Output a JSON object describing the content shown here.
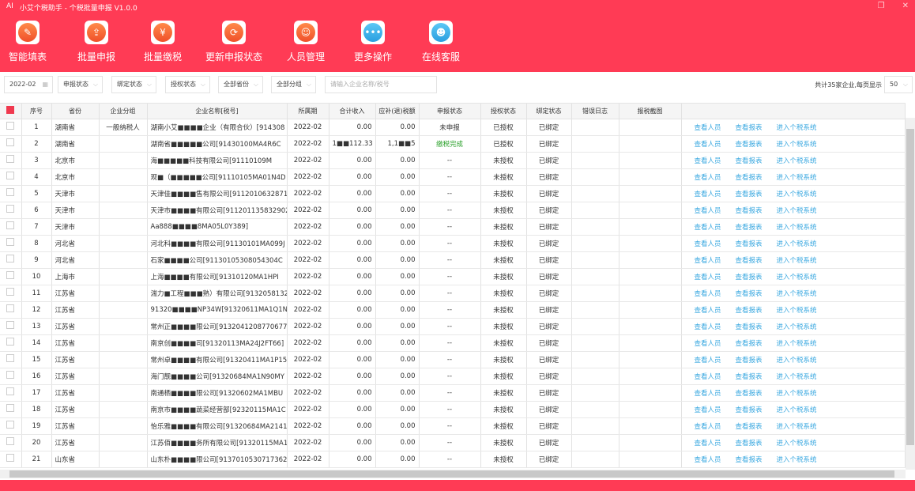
{
  "app": {
    "logo": "AI",
    "title": "小艾个税助手 - 个税批量申报  V1.0.0"
  },
  "window": {
    "restore": "❐",
    "close": "✕"
  },
  "toolbar": [
    {
      "label": "智能填表",
      "icon": "form-edit-icon",
      "glyph": "✎",
      "color": "orange"
    },
    {
      "label": "批量申报",
      "icon": "document-upload-icon",
      "glyph": "⇪",
      "color": "orange"
    },
    {
      "label": "批量缴税",
      "icon": "payment-hand-icon",
      "glyph": "¥",
      "color": "orange"
    },
    {
      "label": "更新申报状态",
      "icon": "refresh-icon",
      "glyph": "⟳",
      "color": "orange"
    },
    {
      "label": "人员管理",
      "icon": "user-settings-icon",
      "glyph": "☺",
      "color": "orange"
    },
    {
      "label": "更多操作",
      "icon": "more-icon",
      "glyph": "•••",
      "color": "blue"
    },
    {
      "label": "在线客服",
      "icon": "chat-icon",
      "glyph": "☻",
      "color": "blue"
    }
  ],
  "filters": {
    "period": "2022-02",
    "declare_status": "申报状态",
    "bind_status": "绑定状态",
    "auth_status": "授权状态",
    "province": "全部省份",
    "group": "全部分组",
    "search_placeholder": "请输入企业名称/税号",
    "total": "共计35家企业,每页显示",
    "page_size": "50"
  },
  "columns": [
    "序号",
    "省份",
    "企业分组",
    "企业名称[税号]",
    "所属期",
    "合计收入",
    "应补(退)税额",
    "申报状态",
    "授权状态",
    "绑定状态",
    "错误日志",
    "报税截图"
  ],
  "actions": [
    "查看人员",
    "查看报表",
    "进入个税系统"
  ],
  "colors": {
    "brand": "#ff3b55",
    "link": "#3aa8e0",
    "done": "#2aa02a"
  },
  "rows": [
    {
      "no": "1",
      "province": "湖南省",
      "group": "一般纳税人",
      "name": "湖南小艾■■■■企业（有限合伙）[914308",
      "period": "2022-02",
      "income": "0.00",
      "tax": "0.00",
      "declare": "未申报",
      "auth": "已授权",
      "bind": "已绑定"
    },
    {
      "no": "2",
      "province": "湖南省",
      "group": "",
      "name": "湖南省■■■■■公司[91430100MA4R6C",
      "period": "2022-02",
      "income": "1■■112.33",
      "tax": "1,1■■5",
      "declare": "缴税完成",
      "auth": "已授权",
      "bind": "已绑定"
    },
    {
      "no": "3",
      "province": "北京市",
      "group": "",
      "name": "海■■■■■科技有限公司[91110109M",
      "period": "2022-02",
      "income": "0.00",
      "tax": "0.00",
      "declare": "--",
      "auth": "未授权",
      "bind": "已绑定"
    },
    {
      "no": "4",
      "province": "北京市",
      "group": "",
      "name": "观■（■■■■■公司[91110105MA01N4D",
      "period": "2022-02",
      "income": "0.00",
      "tax": "0.00",
      "declare": "--",
      "auth": "未授权",
      "bind": "已绑定"
    },
    {
      "no": "5",
      "province": "天津市",
      "group": "",
      "name": "天津佳■■■■售有限公司[9112010632871",
      "period": "2022-02",
      "income": "0.00",
      "tax": "0.00",
      "declare": "--",
      "auth": "未授权",
      "bind": "已绑定"
    },
    {
      "no": "6",
      "province": "天津市",
      "group": "",
      "name": "天津市■■■■有限公司[911201135832902",
      "period": "2022-02",
      "income": "0.00",
      "tax": "0.00",
      "declare": "--",
      "auth": "未授权",
      "bind": "已绑定"
    },
    {
      "no": "7",
      "province": "天津市",
      "group": "",
      "name": "Aa888■■■■8MA05L0Y389]",
      "period": "2022-02",
      "income": "0.00",
      "tax": "0.00",
      "declare": "--",
      "auth": "未授权",
      "bind": "已绑定"
    },
    {
      "no": "8",
      "province": "河北省",
      "group": "",
      "name": "河北科■■■■有限公司[91130101MA099J",
      "period": "2022-02",
      "income": "0.00",
      "tax": "0.00",
      "declare": "--",
      "auth": "未授权",
      "bind": "已绑定"
    },
    {
      "no": "9",
      "province": "河北省",
      "group": "",
      "name": "石家■■■■公司[91130105308054304C",
      "period": "2022-02",
      "income": "0.00",
      "tax": "0.00",
      "declare": "--",
      "auth": "未授权",
      "bind": "已绑定"
    },
    {
      "no": "10",
      "province": "上海市",
      "group": "",
      "name": "上海■■■■有限公司[91310120MA1HPI",
      "period": "2022-02",
      "income": "0.00",
      "tax": "0.00",
      "declare": "--",
      "auth": "未授权",
      "bind": "已绑定"
    },
    {
      "no": "11",
      "province": "江苏省",
      "group": "",
      "name": "湍力■工程■■■熟）有限公司[913205813291",
      "period": "2022-02",
      "income": "0.00",
      "tax": "0.00",
      "declare": "--",
      "auth": "未授权",
      "bind": "已绑定"
    },
    {
      "no": "12",
      "province": "江苏省",
      "group": "",
      "name": "91320■■■■NP34W[91320611MA1Q1NF",
      "period": "2022-02",
      "income": "0.00",
      "tax": "0.00",
      "declare": "--",
      "auth": "未授权",
      "bind": "已绑定"
    },
    {
      "no": "13",
      "province": "江苏省",
      "group": "",
      "name": "常州正■■■■限公司[91320412087706777",
      "period": "2022-02",
      "income": "0.00",
      "tax": "0.00",
      "declare": "--",
      "auth": "未授权",
      "bind": "已绑定"
    },
    {
      "no": "14",
      "province": "江苏省",
      "group": "",
      "name": "南京创■■■■司[91320113MA24J2FT66]",
      "period": "2022-02",
      "income": "0.00",
      "tax": "0.00",
      "declare": "--",
      "auth": "未授权",
      "bind": "已绑定"
    },
    {
      "no": "15",
      "province": "江苏省",
      "group": "",
      "name": "常州卓■■■■有限公司[91320411MA1P15",
      "period": "2022-02",
      "income": "0.00",
      "tax": "0.00",
      "declare": "--",
      "auth": "未授权",
      "bind": "已绑定"
    },
    {
      "no": "16",
      "province": "江苏省",
      "group": "",
      "name": "海门靓■■■■公司[91320684MA1N90MY",
      "period": "2022-02",
      "income": "0.00",
      "tax": "0.00",
      "declare": "--",
      "auth": "未授权",
      "bind": "已绑定"
    },
    {
      "no": "17",
      "province": "江苏省",
      "group": "",
      "name": "南通栖■■■■限公司[91320602MA1MBU",
      "period": "2022-02",
      "income": "0.00",
      "tax": "0.00",
      "declare": "--",
      "auth": "未授权",
      "bind": "已绑定"
    },
    {
      "no": "18",
      "province": "江苏省",
      "group": "",
      "name": "南京市■■■■蔬菜经营部[92320115MA1C",
      "period": "2022-02",
      "income": "0.00",
      "tax": "0.00",
      "declare": "--",
      "auth": "未授权",
      "bind": "已绑定"
    },
    {
      "no": "19",
      "province": "江苏省",
      "group": "",
      "name": "怡乐雅■■■■有限公司[91320684MA2141",
      "period": "2022-02",
      "income": "0.00",
      "tax": "0.00",
      "declare": "--",
      "auth": "未授权",
      "bind": "已绑定"
    },
    {
      "no": "20",
      "province": "江苏省",
      "group": "",
      "name": "江苏佰■■■■务所有限公司[91320115MA1",
      "period": "2022-02",
      "income": "0.00",
      "tax": "0.00",
      "declare": "--",
      "auth": "未授权",
      "bind": "已绑定"
    },
    {
      "no": "21",
      "province": "山东省",
      "group": "",
      "name": "山东朴■■■■限公司[91370105307173627",
      "period": "2022-02",
      "income": "0.00",
      "tax": "0.00",
      "declare": "--",
      "auth": "未授权",
      "bind": "已绑定"
    }
  ]
}
